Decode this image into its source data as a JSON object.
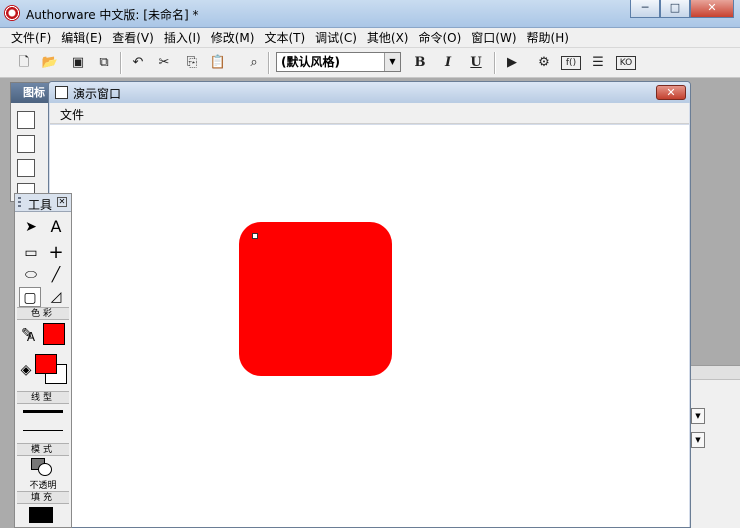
{
  "app": {
    "title": "Authorware 中文版: [未命名] *",
    "window_buttons": {
      "minimize": "─",
      "maximize": "□",
      "close": "✕"
    }
  },
  "menubar": {
    "items": [
      "文件(F)",
      "编辑(E)",
      "查看(V)",
      "插入(I)",
      "修改(M)",
      "文本(T)",
      "调试(C)",
      "其他(X)",
      "命令(O)",
      "窗口(W)",
      "帮助(H)"
    ]
  },
  "toolbar": {
    "style_dropdown_value": "(默认风格)",
    "bold_label": "B",
    "italic_label": "I",
    "underline_label": "U"
  },
  "icons_palette": {
    "title": "图标"
  },
  "presentation_window": {
    "title": "演示窗口",
    "menu": [
      "文件"
    ],
    "close_label": "✕"
  },
  "tools_palette": {
    "title": "工具",
    "sections": {
      "color": "色彩",
      "line": "线型",
      "mode": "模式",
      "fill": "填充"
    },
    "mode_value": "不透明",
    "text_tool_label": "A",
    "text_color_label": "A"
  },
  "colors": {
    "shape_fill": "#ff0000",
    "text_color": "#ff0000",
    "foreground": "#ff0000",
    "fill_pattern": "#000000"
  }
}
